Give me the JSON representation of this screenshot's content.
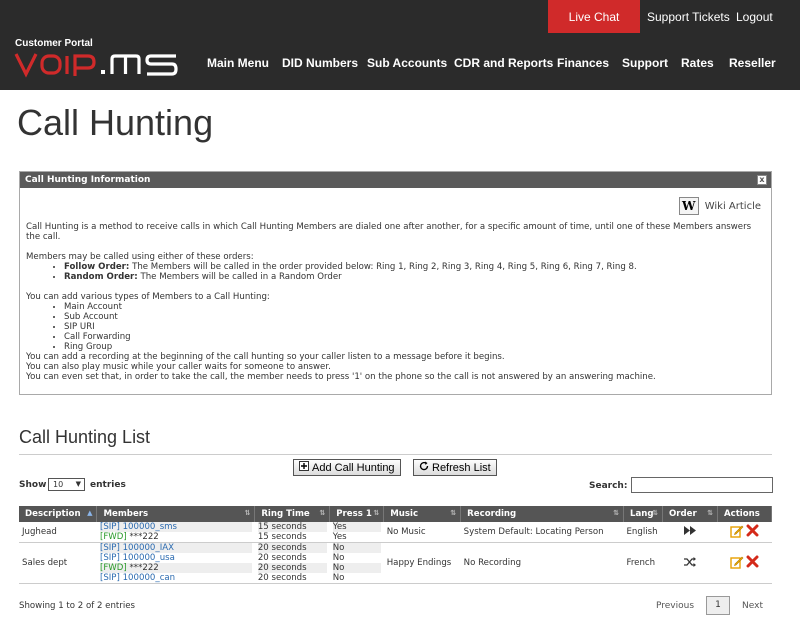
{
  "header": {
    "live_chat": "Live Chat",
    "support_tickets": "Support Tickets",
    "logout": "Logout",
    "portal_label": "Customer Portal",
    "brand": "VoIP.ms",
    "nav": [
      "Main Menu",
      "DID Numbers",
      "Sub Accounts",
      "CDR and Reports",
      "Finances",
      "Support",
      "Rates",
      "Reseller"
    ]
  },
  "page_title": "Call Hunting",
  "info": {
    "heading": "Call Hunting Information",
    "close": "x",
    "wiki_icon": "W",
    "wiki_label": "Wiki Article",
    "intro": "Call Hunting is a method to receive calls in which Call Hunting Members are dialed one after another, for a specific amount of time, until one of these Members answers the call.",
    "orders_intro": "Members may be called using either of these orders:",
    "follow_label": "Follow Order:",
    "follow_text": " The Members will be called in the order provided below: Ring 1, Ring 2, Ring 3, Ring 4, Ring 5, Ring 6, Ring 7, Ring 8.",
    "random_label": "Random Order:",
    "random_text": " The Members will be called in a Random Order",
    "types_intro": "You can add various types of Members to a Call Hunting:",
    "types": [
      "Main Account",
      "Sub Account",
      "SIP URI",
      "Call Forwarding",
      "Ring Group"
    ],
    "notes": [
      "You can add a recording at the beginning of the call hunting so your caller listen to a message before it begins.",
      "You can also play music while your caller waits for someone to answer.",
      "You can even set that, in order to take the call, the member needs to press '1' on the phone so the call is not answered by an answering machine."
    ]
  },
  "list": {
    "title": "Call Hunting List",
    "add_button": "Add Call Hunting",
    "refresh_button": "Refresh List",
    "show_label": "Show",
    "entries_value": "10",
    "entries_label": "entries",
    "search_label": "Search:",
    "columns": [
      "Description",
      "Members",
      "Ring Time",
      "Press 1",
      "Music",
      "Recording",
      "Lang",
      "Order",
      "Actions"
    ],
    "rows": [
      {
        "description": "Jughead",
        "members": [
          {
            "type": "[SIP]",
            "value": "100000_sms",
            "kind": "sip"
          },
          {
            "type": "[FWD]",
            "value": "***222",
            "kind": "fwd"
          }
        ],
        "ring_times": [
          "15 seconds",
          "15 seconds"
        ],
        "press1": [
          "Yes",
          "Yes"
        ],
        "music": "No Music",
        "recording": "System Default: Locating Person",
        "lang": "English",
        "order_icon": "follow-order-icon"
      },
      {
        "description": "Sales dept",
        "members": [
          {
            "type": "[SIP]",
            "value": "100000_IAX",
            "kind": "sip"
          },
          {
            "type": "[SIP]",
            "value": "100000_usa",
            "kind": "sip"
          },
          {
            "type": "[FWD]",
            "value": "***222",
            "kind": "fwd"
          },
          {
            "type": "[SIP]",
            "value": "100000_can",
            "kind": "sip"
          }
        ],
        "ring_times": [
          "20 seconds",
          "20 seconds",
          "20 seconds",
          "20 seconds"
        ],
        "press1": [
          "No",
          "No",
          "No",
          "No"
        ],
        "music": "Happy Endings",
        "recording": "No Recording",
        "lang": "French",
        "order_icon": "random-order-icon"
      }
    ],
    "footer": "Showing 1 to 2 of 2 entries",
    "previous": "Previous",
    "page": "1",
    "next": "Next"
  },
  "colors": {
    "accent_red": "#d02a2a",
    "header_bg": "#2b2b2b",
    "sip_blue": "#2a6ab0",
    "fwd_green": "#2a9a2a"
  }
}
